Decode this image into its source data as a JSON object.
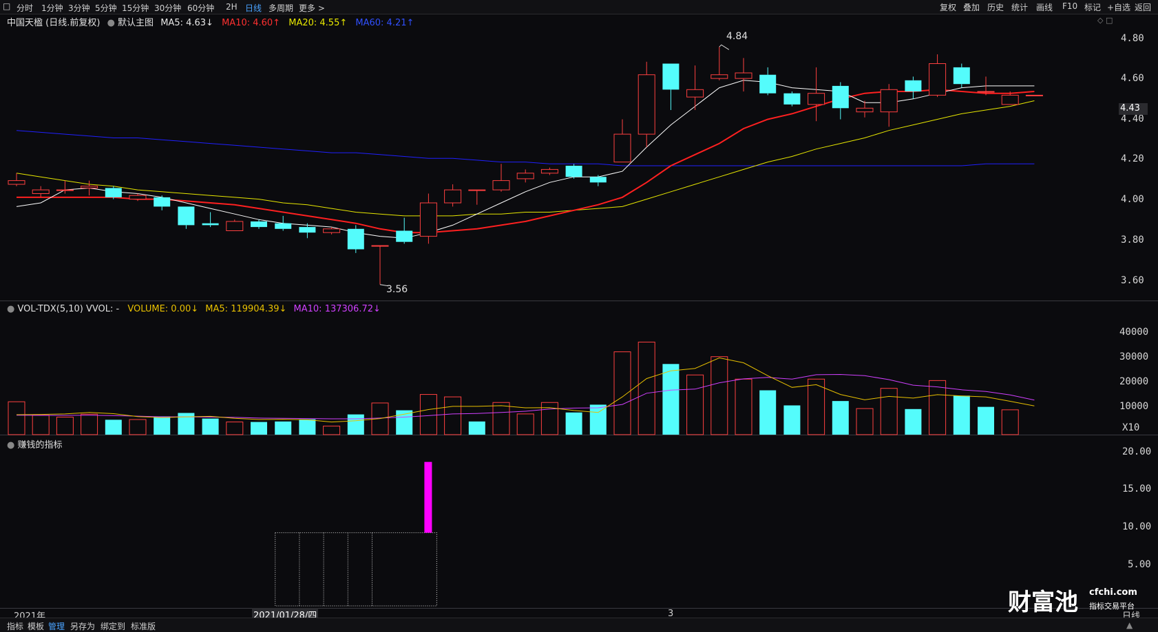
{
  "toolbar": {
    "periods": [
      "分时",
      "1分钟",
      "3分钟",
      "5分钟",
      "15分钟",
      "30分钟",
      "60分钟",
      "2H",
      "日线",
      "多周期",
      "更多 >"
    ],
    "active_period": "日线",
    "right_buttons": [
      "复权",
      "叠加",
      "历史",
      "统计",
      "画线",
      "F10",
      "标记",
      "+自选",
      "返回"
    ]
  },
  "main_chart": {
    "title": "中国天楹 (日线.前复权)",
    "template": "默认主图",
    "ma5_label": "MA5: 4.63↓",
    "ma10_label": "MA10: 4.60↑",
    "ma20_label": "MA20: 4.55↑",
    "ma60_label": "MA60: 4.21↑",
    "high_label": "4.84",
    "low_label": "3.56",
    "current_price": "4.43",
    "y_ticks": [
      "4.80",
      "4.60",
      "4.40",
      "4.20",
      "4.00",
      "3.80",
      "3.60"
    ]
  },
  "volume_chart": {
    "title": "VOL-TDX(5,10) VVOL: -",
    "volume_label": "VOLUME: 0.00↓",
    "ma5_label": "MA5: 119904.39↓",
    "ma10_label": "MA10: 137306.72↓",
    "y_ticks": [
      "40000",
      "30000",
      "20000",
      "10000",
      "X10"
    ]
  },
  "indicator_chart": {
    "title": "赚钱的指标",
    "y_ticks": [
      "20.00",
      "15.00",
      "10.00",
      "5.00"
    ]
  },
  "date_axis": {
    "year_label": "2021年",
    "cursor_date": "2021/01/28/四",
    "mid_label": "3",
    "period_label": "日线"
  },
  "bottom_bar": {
    "items": [
      "指标",
      "模板",
      "管理",
      "另存为",
      "绑定到",
      "标准版"
    ],
    "active_item": "管理"
  },
  "watermark": {
    "brand": "财富池",
    "site": "cfchi.com",
    "sub": "指标交易平台"
  },
  "colors": {
    "up": "#ff4040",
    "down": "#54fcfc",
    "ma5": "#ffffff",
    "ma10": "#ff2020",
    "ma20": "#e8e800",
    "ma60": "#2020ff",
    "vol_ma5": "#e8c000",
    "vol_ma10": "#d040ff",
    "indicator": "#ff00ff"
  },
  "chart_data": {
    "type": "candlestick",
    "candles": [
      {
        "o": 4.1,
        "c": 4.12,
        "h": 4.16,
        "l": 4.09
      },
      {
        "o": 4.05,
        "c": 4.07,
        "h": 4.09,
        "l": 4.03
      },
      {
        "o": 4.07,
        "c": 4.07,
        "h": 4.12,
        "l": 4.05
      },
      {
        "o": 4.08,
        "c": 4.09,
        "h": 4.12,
        "l": 4.04
      },
      {
        "o": 4.08,
        "c": 4.03,
        "h": 4.09,
        "l": 4.02
      },
      {
        "o": 4.02,
        "c": 4.04,
        "h": 4.05,
        "l": 4.01
      },
      {
        "o": 4.03,
        "c": 3.98,
        "h": 4.04,
        "l": 3.96
      },
      {
        "o": 3.98,
        "c": 3.88,
        "h": 3.98,
        "l": 3.86
      },
      {
        "o": 3.89,
        "c": 3.88,
        "h": 3.95,
        "l": 3.87
      },
      {
        "o": 3.85,
        "c": 3.9,
        "h": 3.91,
        "l": 3.85
      },
      {
        "o": 3.9,
        "c": 3.87,
        "h": 3.91,
        "l": 3.86
      },
      {
        "o": 3.89,
        "c": 3.86,
        "h": 3.93,
        "l": 3.85
      },
      {
        "o": 3.87,
        "c": 3.84,
        "h": 3.89,
        "l": 3.81
      },
      {
        "o": 3.84,
        "c": 3.86,
        "h": 3.87,
        "l": 3.83
      },
      {
        "o": 3.86,
        "c": 3.75,
        "h": 3.88,
        "l": 3.73
      },
      {
        "o": 3.77,
        "c": 3.77,
        "h": 3.77,
        "l": 3.56
      },
      {
        "o": 3.85,
        "c": 3.79,
        "h": 3.92,
        "l": 3.78
      },
      {
        "o": 3.82,
        "c": 4.0,
        "h": 4.05,
        "l": 3.78
      },
      {
        "o": 4.0,
        "c": 4.07,
        "h": 4.1,
        "l": 3.98
      },
      {
        "o": 4.07,
        "c": 4.07,
        "h": 4.07,
        "l": 3.99
      },
      {
        "o": 4.07,
        "c": 4.12,
        "h": 4.21,
        "l": 4.06
      },
      {
        "o": 4.13,
        "c": 4.16,
        "h": 4.18,
        "l": 4.11
      },
      {
        "o": 4.16,
        "c": 4.18,
        "h": 4.19,
        "l": 4.15
      },
      {
        "o": 4.2,
        "c": 4.14,
        "h": 4.21,
        "l": 4.13
      },
      {
        "o": 4.14,
        "c": 4.11,
        "h": 4.15,
        "l": 4.09
      },
      {
        "o": 4.22,
        "c": 4.37,
        "h": 4.45,
        "l": 4.22
      },
      {
        "o": 4.37,
        "c": 4.69,
        "h": 4.76,
        "l": 4.3
      },
      {
        "o": 4.75,
        "c": 4.61,
        "h": 4.75,
        "l": 4.5
      },
      {
        "o": 4.57,
        "c": 4.61,
        "h": 4.74,
        "l": 4.5
      },
      {
        "o": 4.67,
        "c": 4.69,
        "h": 4.84,
        "l": 4.66
      },
      {
        "o": 4.67,
        "c": 4.7,
        "h": 4.78,
        "l": 4.6
      },
      {
        "o": 4.69,
        "c": 4.59,
        "h": 4.73,
        "l": 4.58
      },
      {
        "o": 4.59,
        "c": 4.53,
        "h": 4.6,
        "l": 4.52
      },
      {
        "o": 4.53,
        "c": 4.59,
        "h": 4.73,
        "l": 4.44
      },
      {
        "o": 4.63,
        "c": 4.51,
        "h": 4.65,
        "l": 4.45
      },
      {
        "o": 4.49,
        "c": 4.51,
        "h": 4.55,
        "l": 4.46
      },
      {
        "o": 4.49,
        "c": 4.61,
        "h": 4.64,
        "l": 4.41
      },
      {
        "o": 4.66,
        "c": 4.6,
        "h": 4.68,
        "l": 4.56
      },
      {
        "o": 4.58,
        "c": 4.75,
        "h": 4.8,
        "l": 4.57
      },
      {
        "o": 4.73,
        "c": 4.64,
        "h": 4.75,
        "l": 4.62
      },
      {
        "o": 4.6,
        "c": 4.6,
        "h": 4.68,
        "l": 4.58
      },
      {
        "o": 4.53,
        "c": 4.58,
        "h": 4.6,
        "l": 4.53
      },
      {
        "o": 4.58,
        "c": 4.58,
        "h": 4.58,
        "l": 4.58
      }
    ],
    "ma5": [
      3.98,
      4.0,
      4.07,
      4.08,
      4.06,
      4.05,
      4.03,
      4.0,
      3.97,
      3.94,
      3.91,
      3.89,
      3.88,
      3.87,
      3.84,
      3.82,
      3.81,
      3.84,
      3.88,
      3.94,
      4.0,
      4.06,
      4.11,
      4.14,
      4.14,
      4.17,
      4.3,
      4.42,
      4.52,
      4.62,
      4.66,
      4.65,
      4.62,
      4.61,
      4.6,
      4.54,
      4.54,
      4.56,
      4.59,
      4.62,
      4.63,
      4.63,
      4.63
    ],
    "ma10": [
      4.03,
      4.03,
      4.03,
      4.03,
      4.03,
      4.02,
      4.02,
      4.01,
      4.0,
      3.99,
      3.97,
      3.95,
      3.93,
      3.91,
      3.89,
      3.86,
      3.84,
      3.84,
      3.85,
      3.86,
      3.88,
      3.9,
      3.93,
      3.96,
      3.99,
      4.03,
      4.11,
      4.2,
      4.26,
      4.32,
      4.4,
      4.45,
      4.48,
      4.52,
      4.56,
      4.59,
      4.6,
      4.6,
      4.61,
      4.6,
      4.59,
      4.59,
      4.6
    ],
    "ma20": [
      4.16,
      4.14,
      4.12,
      4.1,
      4.09,
      4.07,
      4.06,
      4.05,
      4.04,
      4.03,
      4.02,
      4.0,
      3.99,
      3.97,
      3.95,
      3.94,
      3.93,
      3.93,
      3.93,
      3.94,
      3.94,
      3.95,
      3.95,
      3.96,
      3.97,
      3.98,
      4.02,
      4.06,
      4.1,
      4.14,
      4.18,
      4.22,
      4.25,
      4.29,
      4.32,
      4.35,
      4.39,
      4.42,
      4.45,
      4.48,
      4.5,
      4.52,
      4.55
    ],
    "ma60": [
      4.39,
      4.38,
      4.37,
      4.36,
      4.35,
      4.35,
      4.34,
      4.33,
      4.32,
      4.31,
      4.3,
      4.29,
      4.28,
      4.27,
      4.27,
      4.26,
      4.25,
      4.24,
      4.24,
      4.23,
      4.22,
      4.22,
      4.21,
      4.21,
      4.21,
      4.2,
      4.2,
      4.2,
      4.2,
      4.2,
      4.2,
      4.2,
      4.2,
      4.2,
      4.2,
      4.2,
      4.2,
      4.2,
      4.2,
      4.2,
      4.21,
      4.21,
      4.21
    ],
    "volume_x10": [
      13500,
      8000,
      7200,
      8400,
      6100,
      6200,
      7500,
      8900,
      6600,
      5200,
      5200,
      5400,
      6300,
      3500,
      8300,
      13000,
      10000,
      16500,
      15500,
      5400,
      13200,
      8500,
      13200,
      9100,
      12300,
      34000,
      38000,
      29000,
      24500,
      32000,
      22800,
      18200,
      12000,
      22800,
      13800,
      10700,
      19000,
      10500,
      22200,
      16000,
      11400,
      10200,
      0
    ],
    "vol_up": [
      true,
      true,
      true,
      true,
      false,
      true,
      false,
      false,
      false,
      true,
      false,
      false,
      false,
      true,
      false,
      true,
      false,
      true,
      true,
      false,
      true,
      true,
      true,
      false,
      false,
      true,
      true,
      false,
      true,
      true,
      true,
      false,
      false,
      true,
      false,
      true,
      true,
      false,
      true,
      false,
      false,
      true,
      true
    ],
    "vol_ma5_x10": [
      8200,
      8300,
      8500,
      9100,
      8600,
      7400,
      7000,
      7300,
      7500,
      6700,
      6200,
      6300,
      6100,
      5200,
      5700,
      6600,
      8400,
      10300,
      11600,
      11600,
      11900,
      11000,
      11100,
      9900,
      9100,
      15500,
      23000,
      26200,
      27200,
      31500,
      29500,
      24200,
      19400,
      20500,
      16500,
      14300,
      15700,
      15000,
      16400,
      15900,
      15500,
      13700,
      11800
    ],
    "vol_ma10_x10": [
      8000,
      7900,
      7900,
      8000,
      7800,
      7600,
      7300,
      7300,
      7200,
      7100,
      6800,
      6700,
      6600,
      6500,
      6500,
      6800,
      7200,
      7800,
      8500,
      8700,
      9100,
      9600,
      10500,
      10900,
      11000,
      12400,
      17000,
      18300,
      18700,
      21300,
      22900,
      23500,
      22800,
      24600,
      24700,
      24200,
      22600,
      20300,
      19600,
      18400,
      17700,
      16300,
      14200
    ],
    "indicator_bar": {
      "index": 17,
      "value": 19.5,
      "base": 10
    },
    "indicator_boxes": {
      "from": 11,
      "to": 17,
      "top": 10,
      "dividers": [
        12,
        13,
        14,
        15
      ]
    },
    "price_ylim": [
      3.5,
      4.9
    ],
    "vol_ylim": [
      0,
      48000
    ],
    "ind_ylim": [
      0,
      21.5
    ]
  }
}
